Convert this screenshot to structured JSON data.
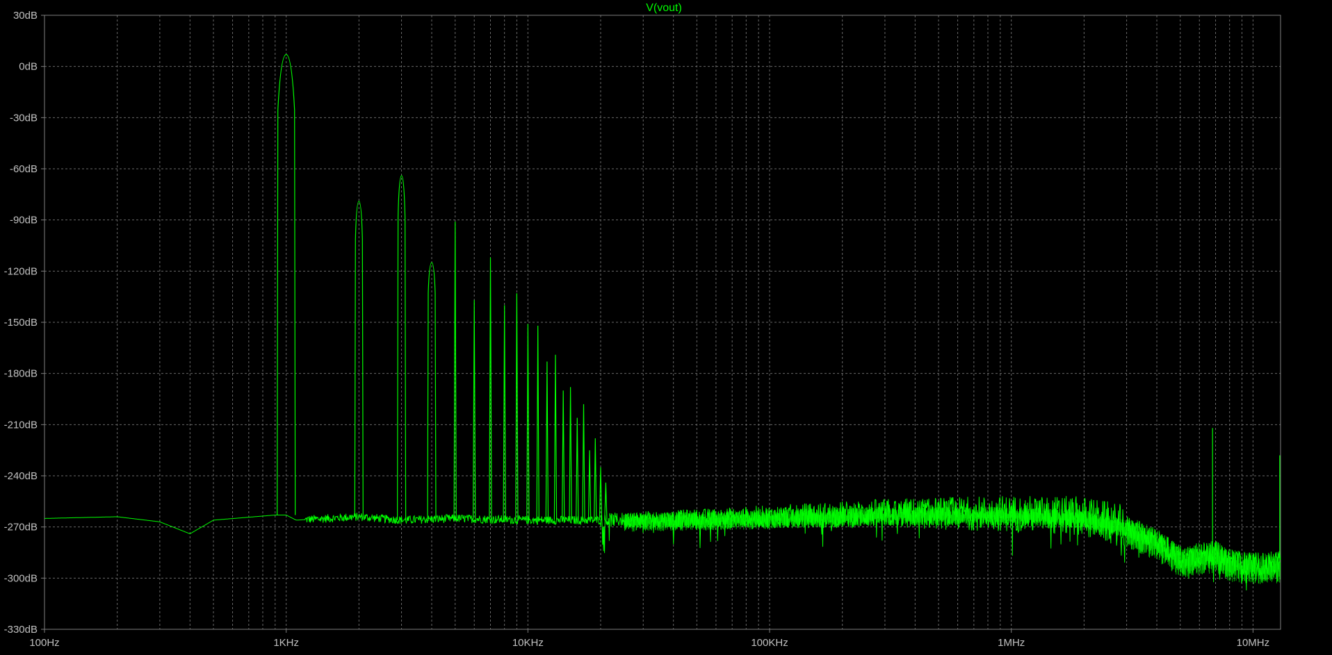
{
  "chart_data": {
    "type": "line",
    "title": "V(vout)",
    "xlabel": "",
    "ylabel": "",
    "x_scale": "log",
    "xlim": [
      100,
      13000000
    ],
    "ylim": [
      -330,
      30
    ],
    "x_ticks": [
      {
        "value": 100,
        "label": "100Hz"
      },
      {
        "value": 1000,
        "label": "1KHz"
      },
      {
        "value": 10000,
        "label": "10KHz"
      },
      {
        "value": 100000,
        "label": "100KHz"
      },
      {
        "value": 1000000,
        "label": "1MHz"
      },
      {
        "value": 10000000,
        "label": "10MHz"
      }
    ],
    "y_ticks": [
      {
        "value": 30,
        "label": "30dB"
      },
      {
        "value": 0,
        "label": "0dB"
      },
      {
        "value": -30,
        "label": "-30dB"
      },
      {
        "value": -60,
        "label": "-60dB"
      },
      {
        "value": -90,
        "label": "-90dB"
      },
      {
        "value": -120,
        "label": "-120dB"
      },
      {
        "value": -150,
        "label": "-150dB"
      },
      {
        "value": -180,
        "label": "-180dB"
      },
      {
        "value": -210,
        "label": "-210dB"
      },
      {
        "value": -240,
        "label": "-240dB"
      },
      {
        "value": -270,
        "label": "-270dB"
      },
      {
        "value": -300,
        "label": "-300dB"
      },
      {
        "value": -330,
        "label": "-330dB"
      }
    ],
    "grid": true,
    "series": [
      {
        "name": "V(vout)",
        "color": "#00ff00",
        "noise_floor": [
          [
            100,
            -265
          ],
          [
            200,
            -264
          ],
          [
            300,
            -267
          ],
          [
            400,
            -274
          ],
          [
            500,
            -266
          ],
          [
            900,
            -263
          ],
          [
            1000,
            -263
          ],
          [
            1100,
            -266
          ],
          [
            2000,
            -264
          ],
          [
            3000,
            -266
          ],
          [
            5000,
            -265
          ],
          [
            10000,
            -266
          ],
          [
            20000,
            -266
          ],
          [
            50000,
            -265
          ],
          [
            100000,
            -264
          ],
          [
            300000,
            -262
          ],
          [
            1000000,
            -262
          ],
          [
            2000000,
            -264
          ],
          [
            3000000,
            -270
          ],
          [
            4000000,
            -278
          ],
          [
            5000000,
            -288
          ],
          [
            6000000,
            -286
          ],
          [
            7000000,
            -285
          ],
          [
            8000000,
            -290
          ],
          [
            10000000,
            -292
          ],
          [
            13000000,
            -291
          ]
        ],
        "harmonics": [
          {
            "freq": 1000,
            "db": 7
          },
          {
            "freq": 2000,
            "db": -79
          },
          {
            "freq": 3000,
            "db": -64
          },
          {
            "freq": 4000,
            "db": -115
          },
          {
            "freq": 5000,
            "db": -91
          },
          {
            "freq": 6000,
            "db": -137
          },
          {
            "freq": 7000,
            "db": -112
          },
          {
            "freq": 8000,
            "db": -140
          },
          {
            "freq": 9000,
            "db": -133
          },
          {
            "freq": 10000,
            "db": -151
          },
          {
            "freq": 11000,
            "db": -152
          },
          {
            "freq": 12000,
            "db": -173
          },
          {
            "freq": 13000,
            "db": -169
          },
          {
            "freq": 14000,
            "db": -190
          },
          {
            "freq": 15000,
            "db": -188
          },
          {
            "freq": 16000,
            "db": -206
          },
          {
            "freq": 17000,
            "db": -198
          },
          {
            "freq": 18000,
            "db": -225
          },
          {
            "freq": 19000,
            "db": -218
          },
          {
            "freq": 20000,
            "db": -235
          },
          {
            "freq": 21000,
            "db": -244
          }
        ],
        "spurs": [
          {
            "freq": 6800000,
            "db": -212
          },
          {
            "freq": 12900000,
            "db": -228
          }
        ]
      }
    ]
  }
}
